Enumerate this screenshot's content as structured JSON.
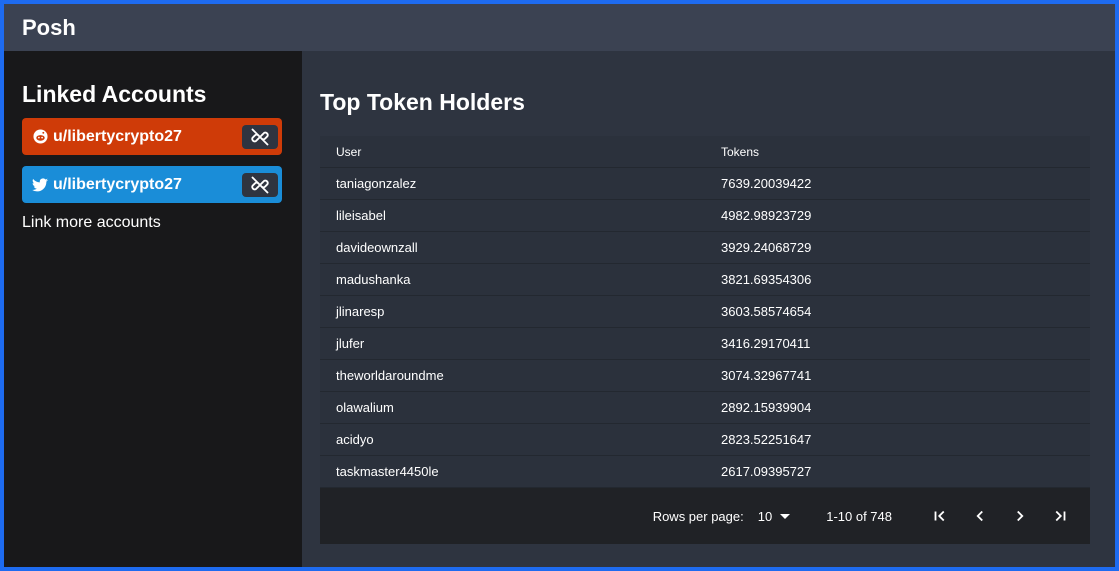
{
  "app": {
    "title": "Posh"
  },
  "sidebar": {
    "heading": "Linked Accounts",
    "accounts": [
      {
        "service": "reddit",
        "icon": "reddit-icon",
        "username": "u/libertycrypto27",
        "color": "#cf3b08"
      },
      {
        "service": "twitter",
        "icon": "twitter-icon",
        "username": "u/libertycrypto27",
        "color": "#1a8dd8"
      }
    ],
    "link_more": "Link more accounts"
  },
  "main": {
    "title": "Top Token Holders",
    "table": {
      "headers": {
        "user": "User",
        "tokens": "Tokens"
      },
      "rows": [
        {
          "user": "taniagonzalez",
          "tokens": "7639.20039422"
        },
        {
          "user": "lileisabel",
          "tokens": "4982.98923729"
        },
        {
          "user": "davideownzall",
          "tokens": "3929.24068729"
        },
        {
          "user": "madushanka",
          "tokens": "3821.69354306"
        },
        {
          "user": "jlinaresp",
          "tokens": "3603.58574654"
        },
        {
          "user": "jlufer",
          "tokens": "3416.29170411"
        },
        {
          "user": "theworldaroundme",
          "tokens": "3074.32967741"
        },
        {
          "user": "olawalium",
          "tokens": "2892.15939904"
        },
        {
          "user": "acidyo",
          "tokens": "2823.52251647"
        },
        {
          "user": "taskmaster4450le",
          "tokens": "2617.09395727"
        }
      ]
    },
    "pagination": {
      "rows_per_page_label": "Rows per page:",
      "rows_per_page_value": "10",
      "range": "1-10 of 748"
    }
  }
}
